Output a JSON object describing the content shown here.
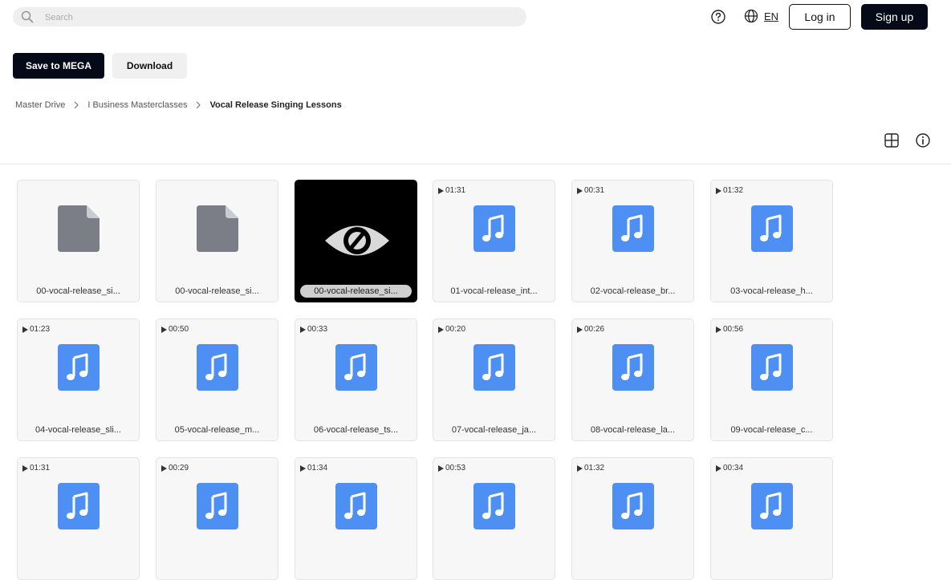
{
  "header": {
    "search_placeholder": "Search",
    "language": "EN",
    "login_label": "Log in",
    "signup_label": "Sign up"
  },
  "actions": {
    "save_label": "Save to MEGA",
    "download_label": "Download"
  },
  "breadcrumb": [
    "Master Drive",
    "I Business Masterclasses",
    "Vocal Release Singing Lessons"
  ],
  "colors": {
    "primary": "#050a18",
    "audio_icon": "#4d8ff3",
    "file_icon": "#7b7e86"
  },
  "files": [
    {
      "name": "00-vocal-release_si...",
      "type": "document",
      "duration": ""
    },
    {
      "name": "00-vocal-release_si...",
      "type": "document",
      "duration": ""
    },
    {
      "name": "00-vocal-release_si...",
      "type": "hidden-preview",
      "duration": ""
    },
    {
      "name": "01-vocal-release_int...",
      "type": "audio",
      "duration": "01:31"
    },
    {
      "name": "02-vocal-release_br...",
      "type": "audio",
      "duration": "00:31"
    },
    {
      "name": "03-vocal-release_h...",
      "type": "audio",
      "duration": "01:32"
    },
    {
      "name": "04-vocal-release_sli...",
      "type": "audio",
      "duration": "01:23"
    },
    {
      "name": "05-vocal-release_m...",
      "type": "audio",
      "duration": "00:50"
    },
    {
      "name": "06-vocal-release_ts...",
      "type": "audio",
      "duration": "00:33"
    },
    {
      "name": "07-vocal-release_ja...",
      "type": "audio",
      "duration": "00:20"
    },
    {
      "name": "08-vocal-release_la...",
      "type": "audio",
      "duration": "00:26"
    },
    {
      "name": "09-vocal-release_c...",
      "type": "audio",
      "duration": "00:56"
    },
    {
      "name": "",
      "type": "audio",
      "duration": "01:31"
    },
    {
      "name": "",
      "type": "audio",
      "duration": "00:29"
    },
    {
      "name": "",
      "type": "audio",
      "duration": "01:34"
    },
    {
      "name": "",
      "type": "audio",
      "duration": "00:53"
    },
    {
      "name": "",
      "type": "audio",
      "duration": "01:32"
    },
    {
      "name": "",
      "type": "audio",
      "duration": "00:34"
    }
  ]
}
